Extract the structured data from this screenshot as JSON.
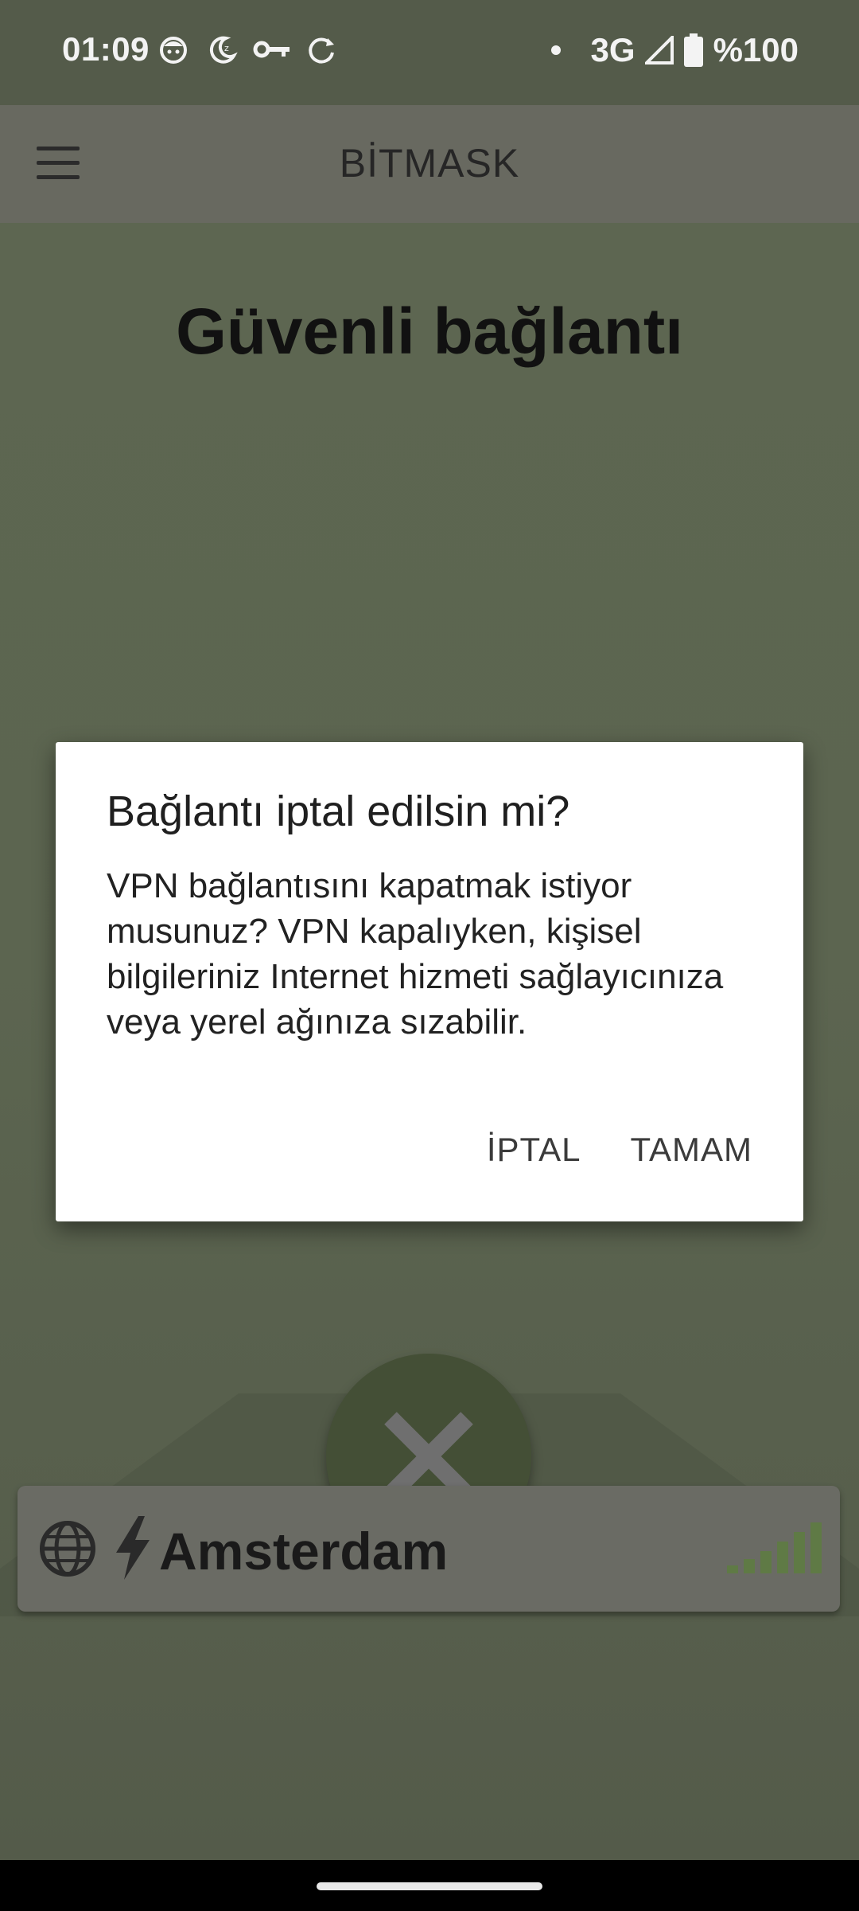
{
  "status_bar": {
    "time": "01:09",
    "network": "3G",
    "battery": "%100",
    "icons": [
      "face-notification-icon",
      "moon-alarm-icon",
      "vpn-key-icon",
      "sync-icon",
      "dot-icon",
      "cell-signal-icon",
      "battery-icon"
    ]
  },
  "app_bar": {
    "title": "BİTMASK",
    "menu_icon": "hamburger-menu-icon"
  },
  "main": {
    "heading": "Güvenli bağlantı",
    "power_button_icon": "close-icon"
  },
  "location": {
    "name": "Amsterdam",
    "globe_icon": "globe-icon",
    "bolt_icon": "bolt-icon",
    "signal_icon": "signal-bars-icon"
  },
  "dialog": {
    "title": "Bağlantı iptal edilsin mi?",
    "message": "VPN bağlantısını kapatmak istiyor musunuz? VPN kapalıyken, kişisel bilgileriniz Internet hizmeti sağlayıcınıza veya yerel ağınıza sızabilir.",
    "cancel_label": "İPTAL",
    "ok_label": "TAMAM"
  },
  "colors": {
    "background": "#545b4a",
    "app_bar": "#686960",
    "power_button": "#444f36",
    "signal_accent": "#5f7a45"
  }
}
